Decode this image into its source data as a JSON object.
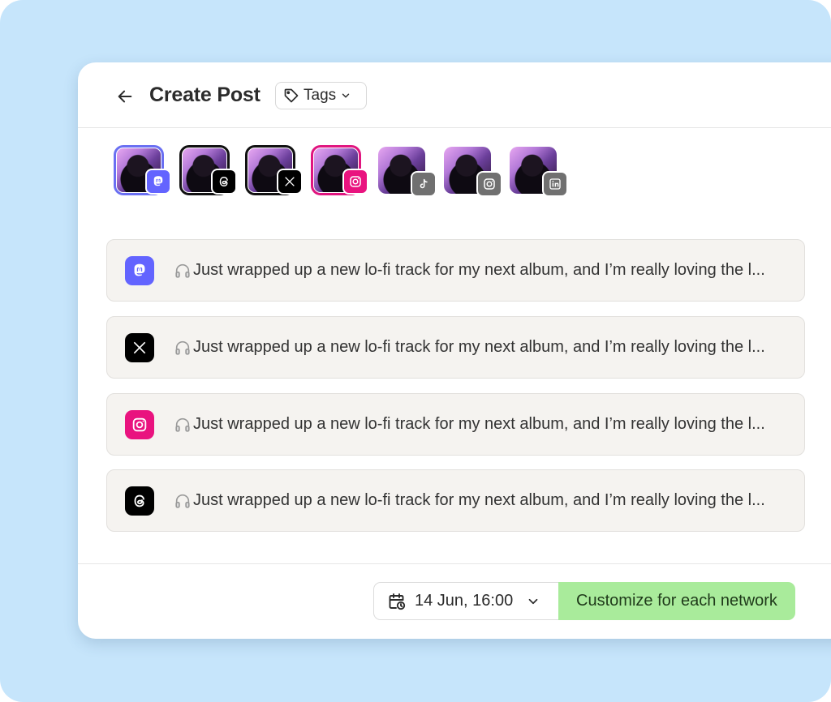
{
  "header": {
    "title": "Create Post",
    "tags_label": "Tags"
  },
  "accounts": [
    {
      "network": "Mastodon",
      "selected": true,
      "ring_color": "#6a6ff2",
      "badge_color": "#6364ff",
      "badge_icon": "mastodon-icon"
    },
    {
      "network": "Threads",
      "selected": true,
      "ring_color": "#111111",
      "badge_color": "#000000",
      "badge_icon": "threads-icon"
    },
    {
      "network": "X",
      "selected": true,
      "ring_color": "#111111",
      "badge_color": "#000000",
      "badge_icon": "x-icon"
    },
    {
      "network": "Instagram",
      "selected": true,
      "ring_color": "#e0157f",
      "badge_color": "#e9137f",
      "badge_icon": "instagram-icon"
    },
    {
      "network": "TikTok",
      "selected": false,
      "badge_color": "#707070",
      "badge_icon": "tiktok-icon"
    },
    {
      "network": "Instagram",
      "selected": false,
      "badge_color": "#707070",
      "badge_icon": "instagram-icon"
    },
    {
      "network": "LinkedIn",
      "selected": false,
      "badge_color": "#707070",
      "badge_icon": "linkedin-icon"
    }
  ],
  "posts": [
    {
      "network": "Mastodon",
      "icon": "mastodon-icon",
      "icon_color": "#6364ff",
      "emoji_icon": "headphones-icon",
      "text": "Just wrapped up a new lo-fi track for my next album, and I’m really loving the l..."
    },
    {
      "network": "X",
      "icon": "x-icon",
      "icon_color": "#000000",
      "emoji_icon": "headphones-icon",
      "text": "Just wrapped up a new lo-fi track for my next album, and I’m really loving the l..."
    },
    {
      "network": "Instagram",
      "icon": "instagram-icon",
      "icon_color": "#e9137f",
      "emoji_icon": "headphones-icon",
      "text": "Just wrapped up a new lo-fi track for my next album, and I’m really loving the l..."
    },
    {
      "network": "Threads",
      "icon": "threads-icon",
      "icon_color": "#000000",
      "emoji_icon": "headphones-icon",
      "text": "Just wrapped up a new lo-fi track for my next album, and I’m really loving the l..."
    }
  ],
  "footer": {
    "schedule_label": "14 Jun, 16:00",
    "customize_label": "Customize for each network",
    "customize_color": "#a9eb9b"
  }
}
